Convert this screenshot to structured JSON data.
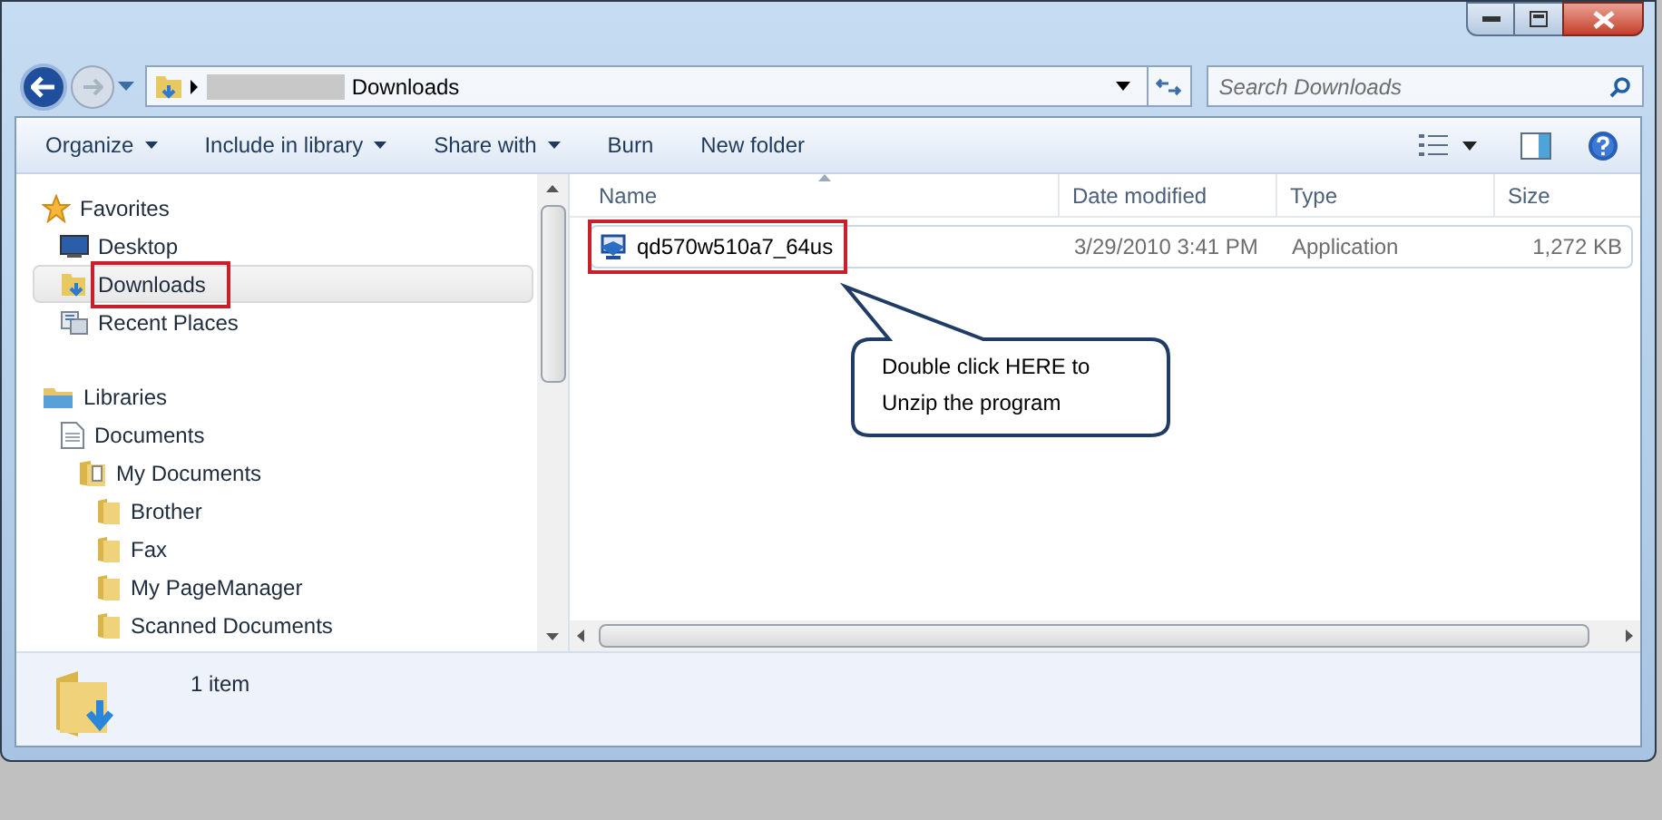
{
  "address": {
    "crumbs": [
      "Downloads"
    ]
  },
  "search": {
    "placeholder": "Search Downloads"
  },
  "toolbar": [
    {
      "label": "Organize",
      "dropdown": true
    },
    {
      "label": "Include in library",
      "dropdown": true
    },
    {
      "label": "Share with",
      "dropdown": true
    },
    {
      "label": "Burn",
      "dropdown": false
    },
    {
      "label": "New folder",
      "dropdown": false
    }
  ],
  "nav": [
    {
      "label": "Favorites",
      "kind": "star",
      "selected": false,
      "highlighted": false,
      "children": [
        {
          "label": "Desktop",
          "kind": "desktop",
          "selected": false,
          "highlighted": false
        },
        {
          "label": "Downloads",
          "kind": "downloads",
          "selected": true,
          "highlighted": true
        },
        {
          "label": "Recent Places",
          "kind": "recent",
          "selected": false,
          "highlighted": false
        }
      ]
    },
    {
      "label": "Libraries",
      "kind": "library",
      "selected": false,
      "highlighted": false,
      "children": [
        {
          "label": "Documents",
          "kind": "document",
          "selected": false,
          "highlighted": false,
          "children": [
            {
              "label": "My Documents",
              "kind": "docfolder",
              "selected": false,
              "highlighted": false,
              "children": [
                {
                  "label": "Brother",
                  "kind": "folder",
                  "selected": false,
                  "highlighted": false
                },
                {
                  "label": "Fax",
                  "kind": "folder",
                  "selected": false,
                  "highlighted": false
                },
                {
                  "label": "My PageManager",
                  "kind": "folder",
                  "selected": false,
                  "highlighted": false
                },
                {
                  "label": "Scanned Documents",
                  "kind": "folder",
                  "selected": false,
                  "highlighted": false
                }
              ]
            }
          ]
        }
      ]
    }
  ],
  "columns": [
    "Name",
    "Date modified",
    "Type",
    "Size"
  ],
  "files": [
    {
      "name": "qd570w510a7_64us",
      "date": "3/29/2010 3:41 PM",
      "type": "Application",
      "size": "1,272 KB",
      "highlighted": true
    }
  ],
  "callout": {
    "text": "Double click HERE to Unzip the program"
  },
  "status": {
    "count": "1 item"
  }
}
